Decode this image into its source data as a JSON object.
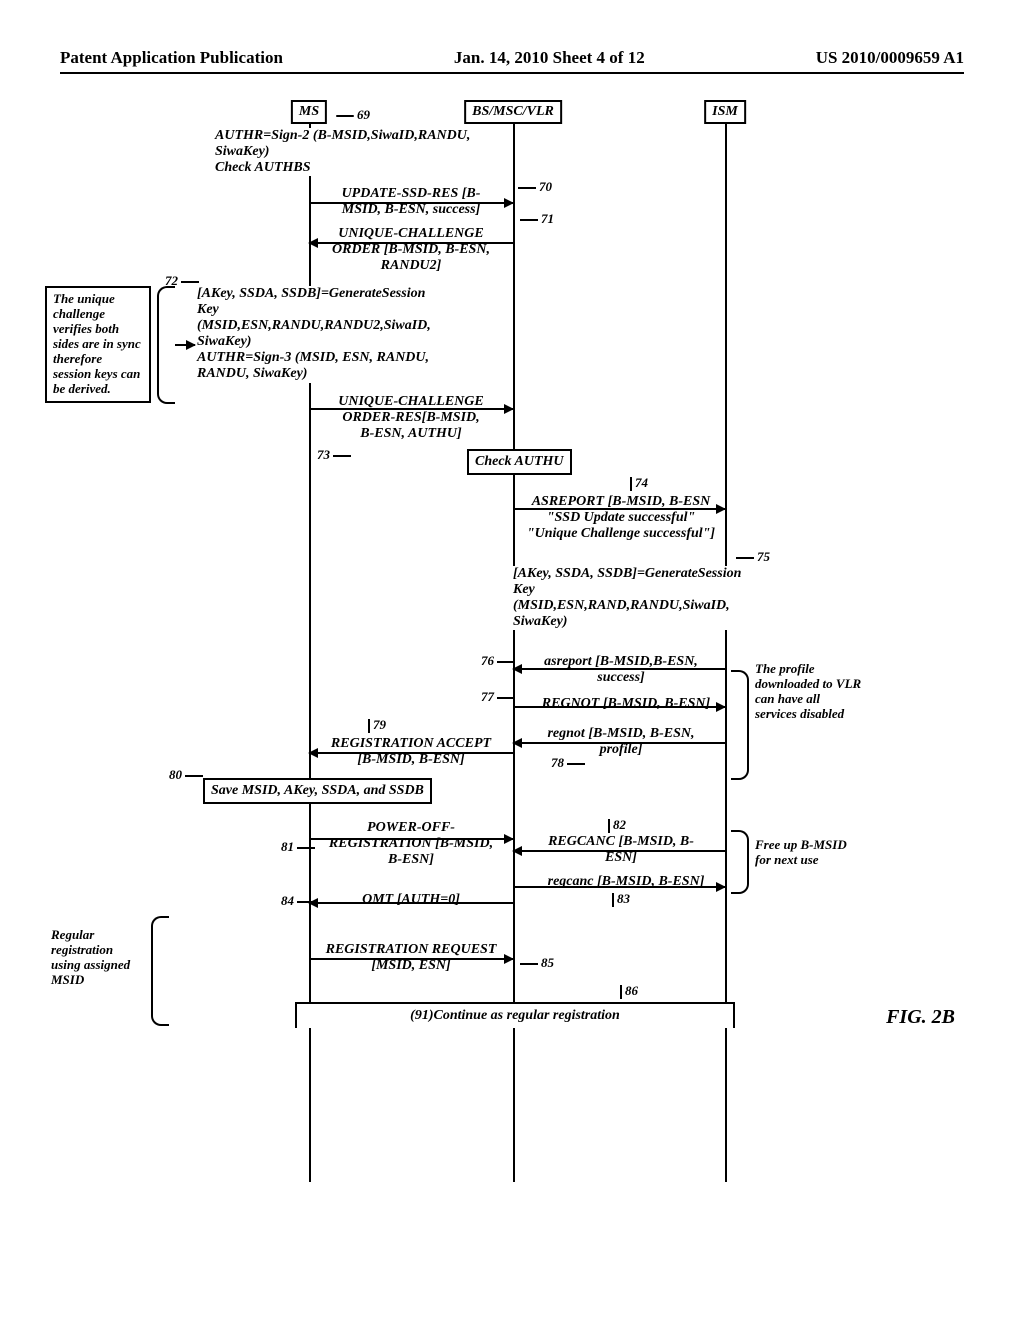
{
  "header": {
    "left": "Patent Application Publication",
    "center": "Jan. 14, 2010  Sheet 4 of 12",
    "right": "US 2010/0009659 A1"
  },
  "actors": {
    "ms": "MS",
    "bs": "BS/MSC/VLR",
    "ism": "ISM"
  },
  "steps": {
    "s69": {
      "ref": "69",
      "lines": [
        "AUTHR=Sign-2 (B-MSID,SiwaID,RANDU,",
        "SiwaKey)",
        "Check AUTHBS"
      ]
    },
    "s70": {
      "ref": "70",
      "lines": [
        "UPDATE-SSD-RES [B-",
        "MSID, B-ESN, success]"
      ]
    },
    "s71": {
      "ref": "71",
      "lines": [
        "UNIQUE-CHALLENGE",
        "ORDER [B-MSID, B-ESN,",
        "RANDU2]"
      ]
    },
    "s72": {
      "ref": "72",
      "lines": [
        "[AKey, SSDA, SSDB]=GenerateSession",
        "Key",
        "(MSID,ESN,RANDU,RANDU2,SiwaID,",
        "SiwaKey)",
        "AUTHR=Sign-3 (MSID, ESN, RANDU,",
        "RANDU, SiwaKey)"
      ]
    },
    "s73": {
      "ref": "73",
      "lines": [
        "UNIQUE-CHALLENGE",
        "ORDER-RES[B-MSID,",
        "B-ESN, AUTHU]"
      ]
    },
    "checkAuthu": "Check AUTHU",
    "s74": {
      "ref": "74",
      "lines": [
        "ASREPORT [B-MSID, B-ESN",
        "\"SSD Update successful\"",
        "\"Unique Challenge successful\"]"
      ]
    },
    "s75": {
      "ref": "75",
      "lines": [
        "[AKey, SSDA, SSDB]=GenerateSession",
        "Key",
        "(MSID,ESN,RAND,RANDU,SiwaID,",
        "SiwaKey)"
      ]
    },
    "s76": {
      "ref": "76",
      "lines": [
        "asreport [B-MSID,B-ESN,",
        "success]"
      ]
    },
    "s77": {
      "ref": "77",
      "lines": [
        "REGNOT [B-MSID, B-ESN]"
      ]
    },
    "s78": {
      "ref": "78",
      "lines": [
        "regnot [B-MSID, B-ESN,",
        "profile]"
      ]
    },
    "s79": {
      "ref": "79",
      "lines": [
        "REGISTRATION ACCEPT",
        "[B-MSID, B-ESN]"
      ]
    },
    "s80": {
      "ref": "80",
      "text": "Save MSID, AKey, SSDA, and SSDB"
    },
    "s81": {
      "ref": "81",
      "lines": [
        "POWER-OFF-",
        "REGISTRATION [B-MSID,",
        "B-ESN]"
      ]
    },
    "s82": {
      "ref": "82",
      "lines": [
        "REGCANC [B-MSID, B-",
        "ESN]"
      ]
    },
    "s83": {
      "ref": "83",
      "lines": [
        "regcanc [B-MSID, B-ESN]"
      ]
    },
    "s84": {
      "ref": "84",
      "lines": [
        "OMT [AUTH=0]"
      ]
    },
    "s85": {
      "ref": "85",
      "lines": [
        "REGISTRATION REQUEST",
        "[MSID, ESN]"
      ]
    },
    "s86": {
      "ref": "86",
      "text": "(91)Continue as regular registration"
    }
  },
  "notes": {
    "left_sync": "The unique challenge verifies both sides are in sync therefore session keys can be derived.",
    "left_reg": "Regular registration using assigned MSID",
    "right_profile": "The profile downloaded to VLR can have all services disabled",
    "right_free": "Free up B-MSID for next use"
  },
  "figure": "FIG. 2B"
}
